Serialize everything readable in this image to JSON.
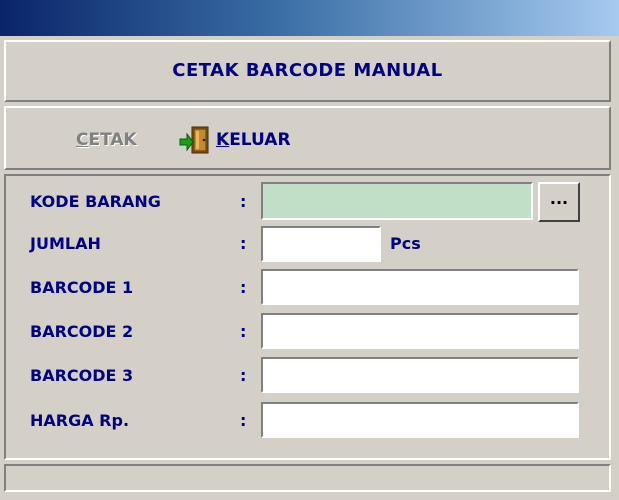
{
  "window": {
    "title": ""
  },
  "header": {
    "title": "CETAK BARCODE MANUAL"
  },
  "toolbar": {
    "cetak": {
      "label_underlined": "C",
      "label_rest": "ETAK",
      "enabled": false
    },
    "keluar": {
      "label_underlined": "K",
      "label_rest": "ELUAR",
      "icon": "exit-door-icon",
      "enabled": true
    }
  },
  "form": {
    "kode_barang": {
      "label": "KODE BARANG",
      "colon": ":",
      "value": "",
      "browse_label": "..."
    },
    "jumlah": {
      "label": "JUMLAH",
      "colon": ":",
      "value": "",
      "unit": "Pcs"
    },
    "barcode1": {
      "label": "BARCODE 1",
      "colon": ":",
      "value": ""
    },
    "barcode2": {
      "label": "BARCODE 2",
      "colon": ":",
      "value": ""
    },
    "barcode3": {
      "label": "BARCODE 3",
      "colon": ":",
      "value": ""
    },
    "harga": {
      "label": "HARGA Rp.",
      "colon": ":",
      "value": ""
    }
  },
  "status": {
    "text": ""
  },
  "colors": {
    "label": "#000080",
    "face": "#d4d0c8",
    "kode_field": "#c1dfc6",
    "titlebar_start": "#0a246a",
    "titlebar_end": "#a6caf0"
  }
}
